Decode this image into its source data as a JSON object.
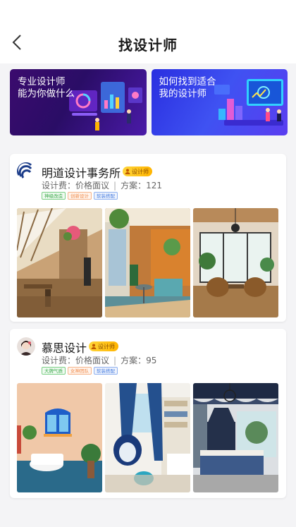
{
  "header": {
    "title": "找设计师"
  },
  "banners": [
    {
      "text": [
        "专业设计师",
        "能为你做什么"
      ]
    },
    {
      "text": [
        "如何找到适合",
        "我的设计师"
      ]
    }
  ],
  "designers": [
    {
      "name": "明道设计事务所",
      "badge": "设计师",
      "fee_label": "设计费：",
      "fee_value": "价格面议",
      "sep": "|",
      "plans_label": "方案：",
      "plans_value": "121",
      "tags": [
        "神级改造",
        "创新设计",
        "软装搭配"
      ]
    },
    {
      "name": "慕思设计",
      "badge": "设计师",
      "fee_label": "设计费：",
      "fee_value": "价格面议",
      "sep": "|",
      "plans_label": "方案：",
      "plans_value": "95",
      "tags": [
        "大牌气质",
        "女神团队",
        "软装搭配"
      ]
    }
  ],
  "colors": {
    "badge": "#ffc21a",
    "accent_green": "#3aa84a",
    "accent_orange": "#f08a4a",
    "accent_blue": "#4a7fe0"
  },
  "icons": {
    "back": "chevron-left-icon",
    "badge": "person-icon"
  }
}
